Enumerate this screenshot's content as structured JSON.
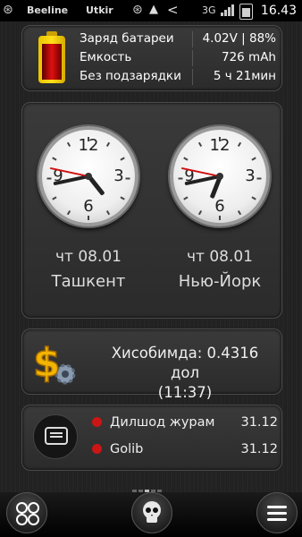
{
  "status_bar": {
    "operator_1": "Beeline",
    "operator_2": "Utkir",
    "network_type": "3G",
    "time": "16.43",
    "icons": [
      "sim1-icon",
      "sim2-icon",
      "drive-icon",
      "share-icon",
      "signal-icon",
      "battery-icon"
    ]
  },
  "battery_widget": {
    "rows": [
      {
        "label": "Заряд батареи",
        "value": "4.02V | 88%"
      },
      {
        "label": "Емкость",
        "value": "726 mAh"
      },
      {
        "label": "Без подзарядки",
        "value": "5 ч 21мин"
      }
    ],
    "charge_level": 0.88,
    "battery_color": "#d01010"
  },
  "clock_widget": {
    "clocks": [
      {
        "date": "чт 08.01",
        "city": "Ташкент",
        "hour": 4,
        "minute": 43,
        "second": 47
      },
      {
        "date": "чт 08.01",
        "city": "Нью-Йорк",
        "hour": 6,
        "minute": 43,
        "second": 47
      }
    ],
    "numerals": [
      "12",
      "3",
      "6",
      "9"
    ]
  },
  "balance_widget": {
    "line1": "Хисобимда: 0.4316 дол",
    "line2": "(11:37)",
    "icon": "dollar-gear-icon"
  },
  "messages_widget": {
    "icon": "message-icon",
    "items": [
      {
        "name": "Дилшод журам",
        "date": "31.12"
      },
      {
        "name": "Golib",
        "date": "31.12"
      }
    ]
  },
  "pager": {
    "pages": 5,
    "active": 2
  },
  "bottom_bar": {
    "left_icon": "apps-grid-icon",
    "center_icon": "skull-icon",
    "right_icon": "menu-icon"
  }
}
